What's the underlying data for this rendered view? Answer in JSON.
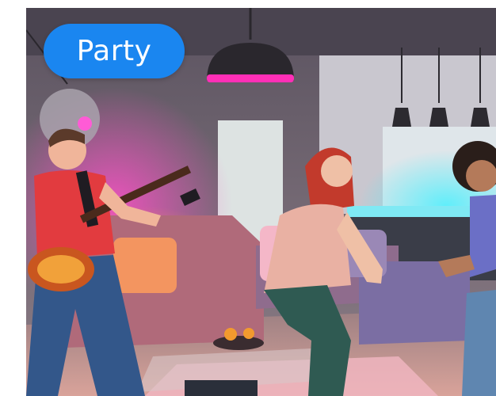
{
  "scene": {
    "mode_label": "Party",
    "pill_color": "#1a86f0",
    "accent_colors": {
      "magenta": "#ff2fb7",
      "cyan": "#37e0e8",
      "warm": "#ff8a3d"
    }
  }
}
